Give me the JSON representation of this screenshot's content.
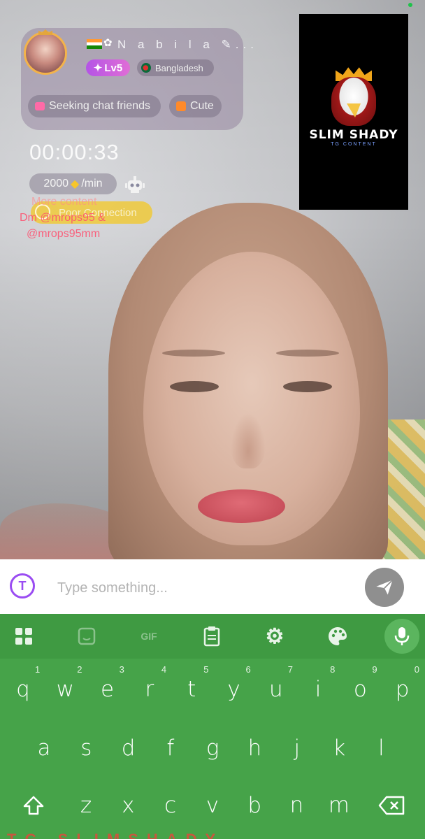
{
  "profile": {
    "name": "N a b i l a ✎...",
    "level": "Lv5",
    "country": "Bangladesh",
    "tags": [
      "Seeking chat friends",
      "Cute"
    ]
  },
  "call": {
    "timer": "00:00:33",
    "rate": "2000",
    "rate_unit": "/min",
    "connection": "Poor Connection",
    "more_content": "More content"
  },
  "watermark": {
    "line1": "Dm @mrops95 &",
    "line2": "@mrops95mm"
  },
  "thumbnail": {
    "title": "SLIM SHADY",
    "subtitle": "TG CONTENT"
  },
  "input": {
    "placeholder": "Type something..."
  },
  "toolbar": {
    "gif_label": "GIF",
    "icons": [
      "apps-icon",
      "sticker-icon",
      "gif-icon",
      "clipboard-icon",
      "gear-icon",
      "palette-icon",
      "mic-icon"
    ]
  },
  "keyboard": {
    "row1": [
      "q",
      "w",
      "e",
      "r",
      "t",
      "y",
      "u",
      "i",
      "o",
      "p"
    ],
    "row1_numbers": [
      "1",
      "2",
      "3",
      "4",
      "5",
      "6",
      "7",
      "8",
      "9",
      "0"
    ],
    "row2": [
      "a",
      "s",
      "d",
      "f",
      "g",
      "h",
      "j",
      "k",
      "l"
    ],
    "row3": [
      "z",
      "x",
      "c",
      "v",
      "b",
      "n",
      "m"
    ]
  },
  "colors": {
    "keyboard_green": "#46a349",
    "toolbar_green": "#3f9a42",
    "level_purple": "#b454e6",
    "connection_yellow": "#f5c81e",
    "watermark_red": "#ff4d6d"
  }
}
